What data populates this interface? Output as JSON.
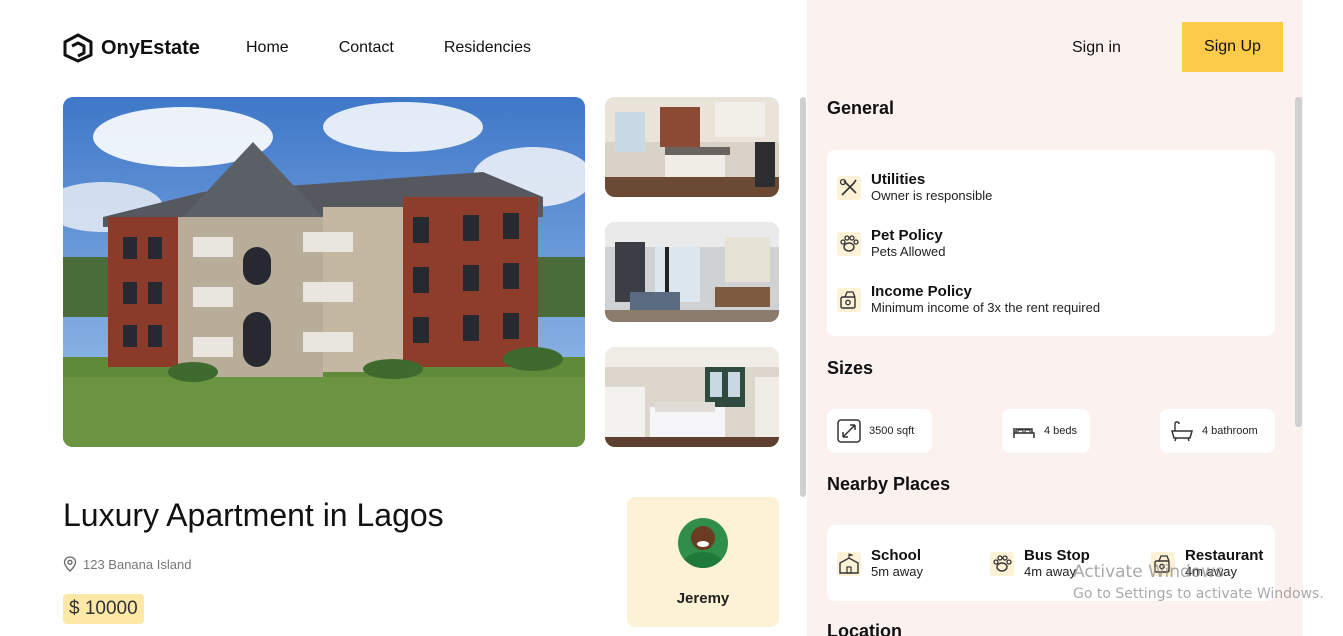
{
  "brand": {
    "name": "OnyEstate"
  },
  "nav": {
    "home": "Home",
    "contact": "Contact",
    "residencies": "Residencies"
  },
  "auth": {
    "signin": "Sign in",
    "signup": "Sign Up"
  },
  "listing": {
    "title": "Luxury Apartment in Lagos",
    "address": "123 Banana Island",
    "price": "$ 10000"
  },
  "agent": {
    "name": "Jeremy"
  },
  "general": {
    "title": "General",
    "items": [
      {
        "label": "Utilities",
        "value": "Owner is responsible",
        "icon": "tools-icon"
      },
      {
        "label": "Pet Policy",
        "value": "Pets Allowed",
        "icon": "paw-icon"
      },
      {
        "label": "Income Policy",
        "value": "Minimum income of 3x the rent required",
        "icon": "money-icon"
      }
    ]
  },
  "sizes": {
    "title": "Sizes",
    "items": [
      {
        "value": "3500 sqft",
        "icon": "area-icon"
      },
      {
        "value": "4 beds",
        "icon": "bed-icon"
      },
      {
        "value": "4 bathroom",
        "icon": "bath-icon"
      }
    ]
  },
  "nearby": {
    "title": "Nearby Places",
    "items": [
      {
        "label": "School",
        "value": "5m away",
        "icon": "school-icon"
      },
      {
        "label": "Bus Stop",
        "value": "4m away",
        "icon": "paw-icon"
      },
      {
        "label": "Restaurant",
        "value": "4m away",
        "icon": "money-icon"
      }
    ]
  },
  "location": {
    "title": "Location"
  },
  "watermark": {
    "line1": "Activate Windows",
    "line2": "Go to Settings to activate Windows."
  },
  "colors": {
    "accent": "#fdcb4a",
    "panel": "#fbf1ef",
    "agentCard": "#fdf1d6",
    "priceBadge": "#fde8a8"
  }
}
